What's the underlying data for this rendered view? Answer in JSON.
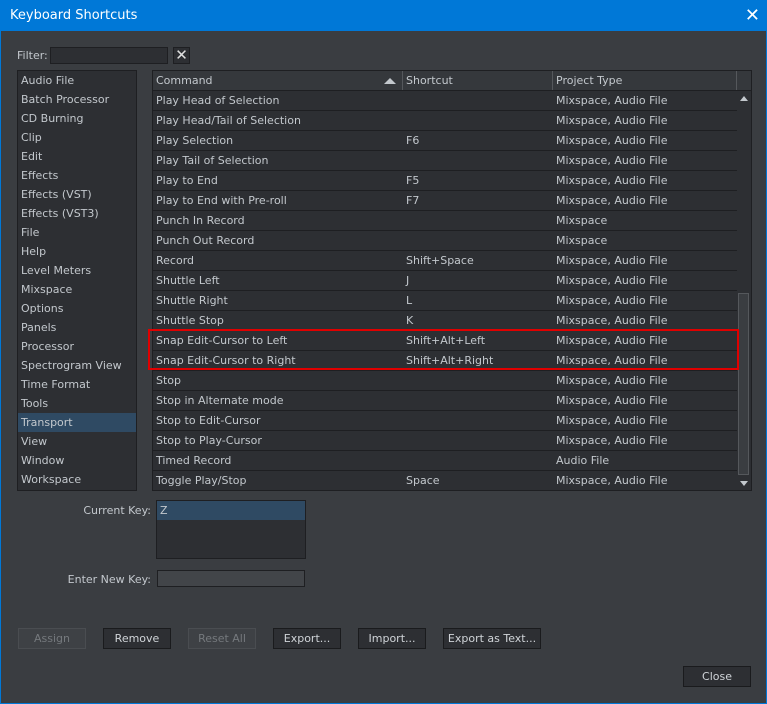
{
  "window": {
    "title": "Keyboard Shortcuts",
    "close_icon": "close-icon"
  },
  "filter": {
    "label": "Filter:",
    "value": "",
    "clear_icon": "x-icon"
  },
  "categories": [
    "Audio File",
    "Batch Processor",
    "CD Burning",
    "Clip",
    "Edit",
    "Effects",
    "Effects (VST)",
    "Effects (VST3)",
    "File",
    "Help",
    "Level Meters",
    "Mixspace",
    "Options",
    "Panels",
    "Processor",
    "Spectrogram View",
    "Time Format",
    "Tools",
    "Transport",
    "View",
    "Window",
    "Workspace"
  ],
  "selected_category": "Transport",
  "table": {
    "columns": [
      "Command",
      "Shortcut",
      "Project Type"
    ],
    "sort": "Command ascending",
    "rows": [
      {
        "command": "Play Head of Selection",
        "shortcut": "",
        "type": "Mixspace, Audio File"
      },
      {
        "command": "Play Head/Tail of Selection",
        "shortcut": "",
        "type": "Mixspace, Audio File"
      },
      {
        "command": "Play Selection",
        "shortcut": "F6",
        "type": "Mixspace, Audio File"
      },
      {
        "command": "Play Tail of Selection",
        "shortcut": "",
        "type": "Mixspace, Audio File"
      },
      {
        "command": "Play to End",
        "shortcut": "F5",
        "type": "Mixspace, Audio File"
      },
      {
        "command": "Play to End with Pre-roll",
        "shortcut": "F7",
        "type": "Mixspace, Audio File"
      },
      {
        "command": "Punch In Record",
        "shortcut": "",
        "type": "Mixspace"
      },
      {
        "command": "Punch Out Record",
        "shortcut": "",
        "type": "Mixspace"
      },
      {
        "command": "Record",
        "shortcut": "Shift+Space",
        "type": "Mixspace, Audio File"
      },
      {
        "command": "Shuttle Left",
        "shortcut": "J",
        "type": "Mixspace, Audio File"
      },
      {
        "command": "Shuttle Right",
        "shortcut": "L",
        "type": "Mixspace, Audio File"
      },
      {
        "command": "Shuttle Stop",
        "shortcut": "K",
        "type": "Mixspace, Audio File"
      },
      {
        "command": "Snap Edit-Cursor to Left",
        "shortcut": "Shift+Alt+Left",
        "type": "Mixspace, Audio File",
        "highlighted": true
      },
      {
        "command": "Snap Edit-Cursor to Right",
        "shortcut": "Shift+Alt+Right",
        "type": "Mixspace, Audio File",
        "highlighted": true
      },
      {
        "command": "Stop",
        "shortcut": "",
        "type": "Mixspace, Audio File"
      },
      {
        "command": "Stop in Alternate mode",
        "shortcut": "",
        "type": "Mixspace, Audio File"
      },
      {
        "command": "Stop to Edit-Cursor",
        "shortcut": "",
        "type": "Mixspace, Audio File"
      },
      {
        "command": "Stop to Play-Cursor",
        "shortcut": "",
        "type": "Mixspace, Audio File"
      },
      {
        "command": "Timed Record",
        "shortcut": "",
        "type": "Audio File"
      },
      {
        "command": "Toggle Play/Stop",
        "shortcut": "Space",
        "type": "Mixspace, Audio File"
      }
    ]
  },
  "current_key": {
    "label": "Current Key:",
    "values": [
      "Z"
    ]
  },
  "new_key": {
    "label": "Enter New Key:",
    "value": ""
  },
  "buttons": {
    "assign": "Assign",
    "remove": "Remove",
    "reset_all": "Reset All",
    "export": "Export...",
    "import": "Import...",
    "export_text": "Export as Text...",
    "close": "Close"
  },
  "colors": {
    "titlebar": "#0078d7",
    "selection": "#2f4a63",
    "highlight_box": "#e00000",
    "background": "#3a3d41"
  }
}
